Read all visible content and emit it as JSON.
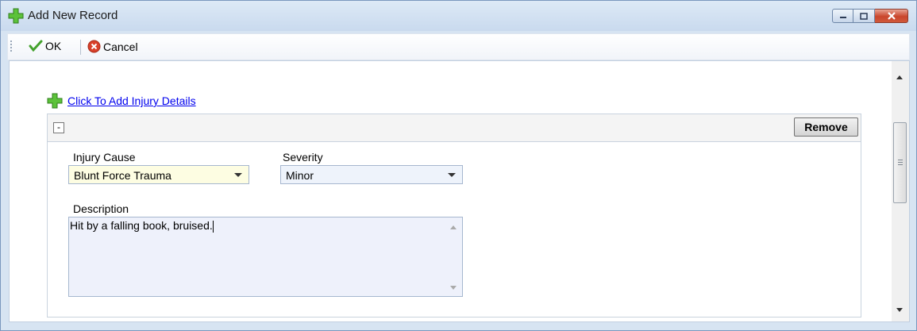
{
  "window": {
    "title": "Add New Record"
  },
  "toolbar": {
    "ok_label": "OK",
    "cancel_label": "Cancel"
  },
  "injury": {
    "add_link": "Click To Add Injury Details",
    "collapse_symbol": "-",
    "remove_label": "Remove",
    "cause_label": "Injury Cause",
    "cause_value": "Blunt Force Trauma",
    "severity_label": "Severity",
    "severity_value": "Minor",
    "description_label": "Description",
    "description_value": "Hit by a falling book, bruised."
  },
  "icons": {
    "add": "plus-icon",
    "ok": "check-icon",
    "cancel": "cancel-icon",
    "dropdown": "chevron-down-icon"
  },
  "colors": {
    "link": "#0000ee",
    "plus_green": "#4caf30",
    "cancel_red": "#d9402a",
    "cause_field_bg": "#fdfde2"
  }
}
